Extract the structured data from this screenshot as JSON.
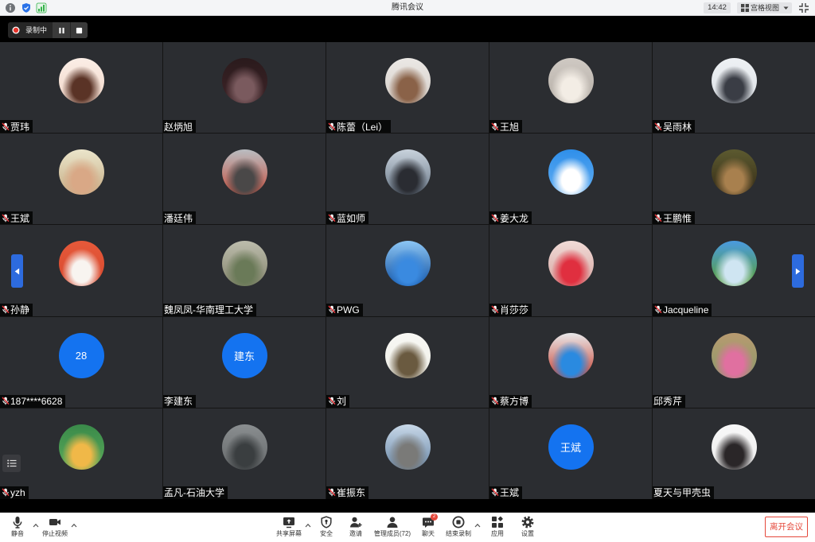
{
  "window": {
    "title": "腾讯会议",
    "time": "14:42",
    "view_mode": "宫格视图",
    "status_icons": [
      "info-icon",
      "shield-icon",
      "signal-icon"
    ],
    "view_mode_icon": "grid-view-icon",
    "exit_fullscreen_icon": "exit-fullscreen-icon"
  },
  "recording": {
    "status": "录制中",
    "icons": [
      "record-dot-icon",
      "pause-icon",
      "stop-icon"
    ]
  },
  "colors": {
    "accent": "#1473f0",
    "danger": "#e5483b",
    "recording": "#e8352c",
    "nav_tab": "#2d6bde"
  },
  "grid": {
    "participants": [
      {
        "name": "贾玮",
        "muted": true,
        "avatar": {
          "colors": [
            "#fbeee6",
            "#5a3326",
            "#f1d7c9"
          ]
        }
      },
      {
        "name": "赵炳旭",
        "muted": false,
        "avatar": {
          "colors": [
            "#2a1a1c",
            "#7a5a5e",
            "#3e2428"
          ]
        }
      },
      {
        "name": "陈蕾（Lei）",
        "muted": true,
        "avatar": {
          "colors": [
            "#ebe8e5",
            "#8a6248",
            "#d6d0ca"
          ]
        }
      },
      {
        "name": "王旭",
        "muted": true,
        "avatar": {
          "colors": [
            "#cfc9c3",
            "#f3ede5",
            "#b6afa7"
          ]
        }
      },
      {
        "name": "吴雨林",
        "muted": true,
        "avatar": {
          "colors": [
            "#eef1f4",
            "#3a3d45",
            "#dde2e7"
          ]
        }
      },
      {
        "name": "王斌",
        "muted": true,
        "avatar": {
          "colors": [
            "#ebe5cb",
            "#d9a886",
            "#c6ad85"
          ]
        }
      },
      {
        "name": "潘廷伟",
        "muted": false,
        "avatar": {
          "colors": [
            "#b9bdc1",
            "#4a4848",
            "#c65242"
          ]
        }
      },
      {
        "name": "蓝如师",
        "muted": true,
        "avatar": {
          "colors": [
            "#c8d2dc",
            "#2a2c32",
            "#6a7888"
          ]
        }
      },
      {
        "name": "姜大龙",
        "muted": true,
        "avatar": {
          "colors": [
            "#2f8fea",
            "#ffffff",
            "#62aef2"
          ]
        }
      },
      {
        "name": "王鹏惟",
        "muted": true,
        "avatar": {
          "colors": [
            "#5c5a30",
            "#a8804e",
            "#362c16"
          ]
        }
      },
      {
        "name": "孙静",
        "muted": true,
        "avatar": {
          "colors": [
            "#e6593a",
            "#f8f4f0",
            "#d8492e"
          ]
        }
      },
      {
        "name": "魏凤凤-华南理工大学",
        "muted": false,
        "avatar": {
          "colors": [
            "#bcbcac",
            "#6a7a58",
            "#86866f"
          ]
        }
      },
      {
        "name": "PWG",
        "muted": true,
        "avatar": {
          "colors": [
            "#8cc6f5",
            "#3a8ae0",
            "#12509f"
          ]
        }
      },
      {
        "name": "肖莎莎",
        "muted": true,
        "avatar": {
          "colors": [
            "#f1dbd7",
            "#e02f3f",
            "#d6a6a2"
          ]
        }
      },
      {
        "name": "Jacqueline",
        "muted": true,
        "avatar": {
          "colors": [
            "#4a9ae0",
            "#cfe5f2",
            "#5aa030"
          ]
        }
      },
      {
        "name": "187****6628",
        "muted": true,
        "avatar": {
          "text": "28"
        }
      },
      {
        "name": "李建东",
        "muted": false,
        "avatar": {
          "text": "建东"
        }
      },
      {
        "name": "刘",
        "muted": true,
        "avatar": {
          "colors": [
            "#f8f8f4",
            "#6a5a40",
            "#efefe8"
          ]
        }
      },
      {
        "name": "蔡方博",
        "muted": true,
        "avatar": {
          "colors": [
            "#e8e8ea",
            "#2a8ae0",
            "#c84030"
          ]
        }
      },
      {
        "name": "邱秀芹",
        "muted": false,
        "avatar": {
          "colors": [
            "#b89a70",
            "#e070a0",
            "#8a9a6a"
          ]
        }
      },
      {
        "name": "yzh",
        "muted": true,
        "avatar": {
          "colors": [
            "#3a8a4a",
            "#f0b848",
            "#5aaa5a"
          ]
        }
      },
      {
        "name": "孟凡-石油大学",
        "muted": false,
        "avatar": {
          "colors": [
            "#8a8e90",
            "#3a3e40",
            "#66696b"
          ]
        }
      },
      {
        "name": "崔振东",
        "muted": true,
        "avatar": {
          "colors": [
            "#c8d8e8",
            "#7a7a78",
            "#6a88a8"
          ]
        }
      },
      {
        "name": "王斌",
        "muted": true,
        "avatar": {
          "text": "王斌"
        }
      },
      {
        "name": "夏天与甲壳虫",
        "muted": false,
        "avatar": {
          "colors": [
            "#f8f8f8",
            "#2a2628",
            "#ececec"
          ]
        }
      }
    ]
  },
  "navigation": {
    "prev_icon": "chevron-left-icon",
    "next_icon": "chevron-right-icon",
    "list_icon": "list-icon"
  },
  "toolbar": {
    "mute": {
      "label": "静音",
      "icon": "mic-icon"
    },
    "video": {
      "label": "停止视频",
      "icon": "video-camera-icon"
    },
    "share": {
      "label": "共享屏幕",
      "icon": "share-screen-icon"
    },
    "security": {
      "label": "安全",
      "icon": "shield-icon"
    },
    "invite": {
      "label": "邀请",
      "icon": "add-person-icon"
    },
    "members": {
      "label": "管理成员(72)",
      "icon": "members-icon"
    },
    "chat": {
      "label": "聊天",
      "icon": "chat-icon",
      "badge": "2"
    },
    "end_recording": {
      "label": "结束录制",
      "icon": "stop-record-icon"
    },
    "apps": {
      "label": "应用",
      "icon": "apps-icon"
    },
    "settings": {
      "label": "设置",
      "icon": "gear-icon"
    },
    "leave": {
      "label": "离开会议"
    }
  }
}
